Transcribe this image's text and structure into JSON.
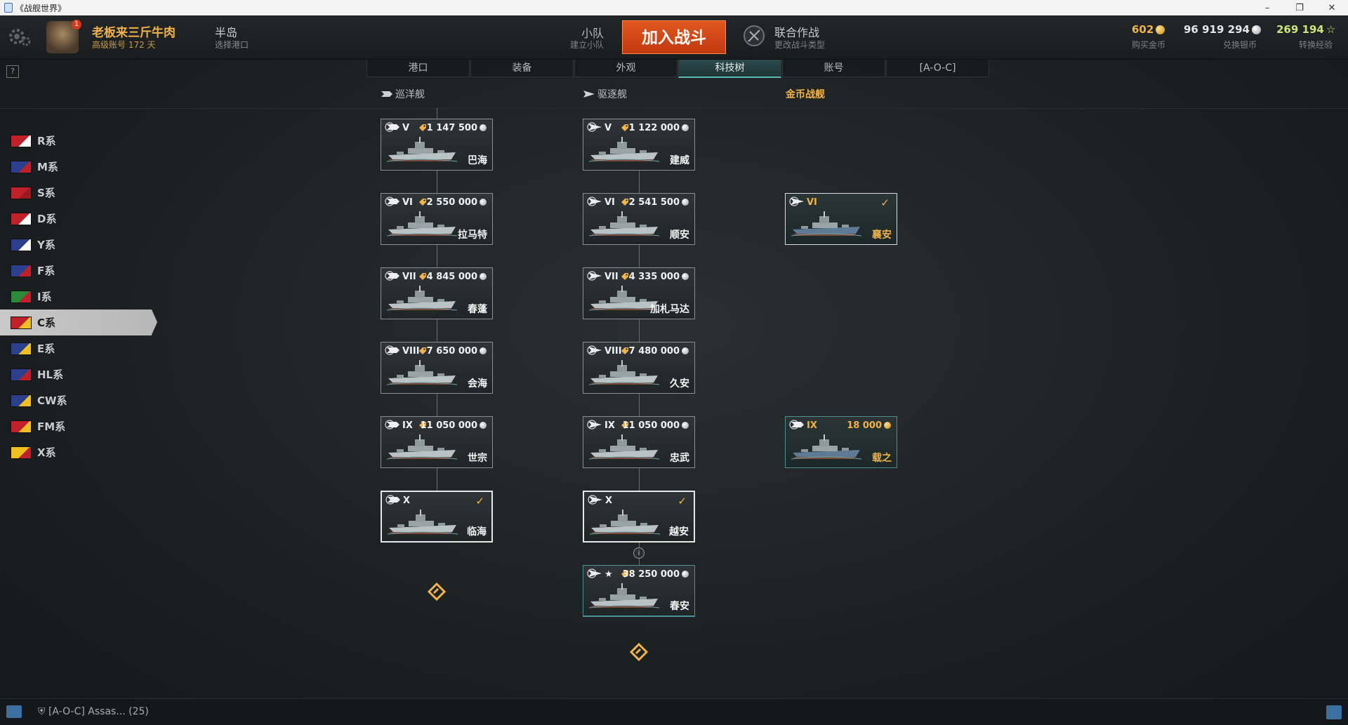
{
  "window": {
    "title": "《战舰世界》",
    "minimize": "–",
    "restore": "❐",
    "close": "✕"
  },
  "header": {
    "user_name": "老板来三斤牛肉",
    "account_status": "高级账号  172 天",
    "avatar_badge": "1",
    "port_name": "半岛",
    "port_sub": "选择港口",
    "squad_title": "小队",
    "squad_sub": "建立小队",
    "battle_button": "加入战斗",
    "mode_title": "联合作战",
    "mode_sub": "更改战斗类型",
    "gold_value": "602",
    "gold_sub": "购买金币",
    "silver_value": "96 919 294",
    "silver_sub": "兑换银币",
    "xp_value": "269 194",
    "xp_sub": "转换经验",
    "gold_color": "#f0b24a",
    "silver_color": "#e6e6e6",
    "xp_color": "#cfe47a"
  },
  "help": "?",
  "tabs": [
    "港口",
    "装备",
    "外观",
    "科技树",
    "账号",
    "[A-O-C]"
  ],
  "active_tab": "科技树",
  "types": {
    "cruiser": "巡洋舰",
    "destroyer": "驱逐舰",
    "premium": "金币战舰"
  },
  "nations": [
    {
      "code": "R系",
      "flag_colors": [
        "#c0202a",
        "#ffffff"
      ]
    },
    {
      "code": "M系",
      "flag_colors": [
        "#2b3f8c",
        "#c0202a"
      ]
    },
    {
      "code": "S系",
      "flag_colors": [
        "#c0202a",
        "#9a1a20"
      ]
    },
    {
      "code": "D系",
      "flag_colors": [
        "#c0202a",
        "#ffffff"
      ]
    },
    {
      "code": "Y系",
      "flag_colors": [
        "#2b3f8c",
        "#ffffff"
      ]
    },
    {
      "code": "F系",
      "flag_colors": [
        "#2b3f8c",
        "#c0202a"
      ]
    },
    {
      "code": "I系",
      "flag_colors": [
        "#2a8a3a",
        "#c0202a"
      ]
    },
    {
      "code": "C系",
      "flag_colors": [
        "#c0202a",
        "#f0c020"
      ]
    },
    {
      "code": "E系",
      "flag_colors": [
        "#2b3f8c",
        "#f0c020"
      ]
    },
    {
      "code": "HL系",
      "flag_colors": [
        "#2b3f8c",
        "#c0202a"
      ]
    },
    {
      "code": "CW系",
      "flag_colors": [
        "#2b3f8c",
        "#f0c020"
      ]
    },
    {
      "code": "FM系",
      "flag_colors": [
        "#c0202a",
        "#f0c020"
      ]
    },
    {
      "code": "X系",
      "flag_colors": [
        "#f0c020",
        "#c0202a"
      ]
    }
  ],
  "active_nation": "C系",
  "cruisers": [
    {
      "tier": "V",
      "price": "1 147 500",
      "name": "巴海"
    },
    {
      "tier": "VI",
      "price": "2 550 000",
      "name": "拉马特"
    },
    {
      "tier": "VII",
      "price": "4 845 000",
      "name": "春蓬"
    },
    {
      "tier": "VIII",
      "price": "7 650 000",
      "name": "会海"
    },
    {
      "tier": "IX",
      "price": "11 050 000",
      "name": "世宗"
    },
    {
      "tier": "X",
      "price": "",
      "name": "临海",
      "owned": true
    }
  ],
  "destroyers": [
    {
      "tier": "V",
      "price": "1 122 000",
      "name": "建威"
    },
    {
      "tier": "VI",
      "price": "2 541 500",
      "name": "顺安"
    },
    {
      "tier": "VII",
      "price": "4 335 000",
      "name": "加札马达"
    },
    {
      "tier": "VIII",
      "price": "7 480 000",
      "name": "久安"
    },
    {
      "tier": "IX",
      "price": "11 050 000",
      "name": "忠武"
    },
    {
      "tier": "X",
      "price": "",
      "name": "越安",
      "owned": true
    },
    {
      "tier": "★",
      "price": "38 250 000",
      "name": "春安",
      "special": true
    }
  ],
  "premium": [
    {
      "tier": "VI",
      "price": "",
      "name": "襄安",
      "owned": true,
      "row": 1
    },
    {
      "tier": "IX",
      "price": "18 000",
      "name": "载之",
      "row": 4
    }
  ],
  "footer": {
    "clan": "[A-O-C]  Assas...  (25)"
  }
}
